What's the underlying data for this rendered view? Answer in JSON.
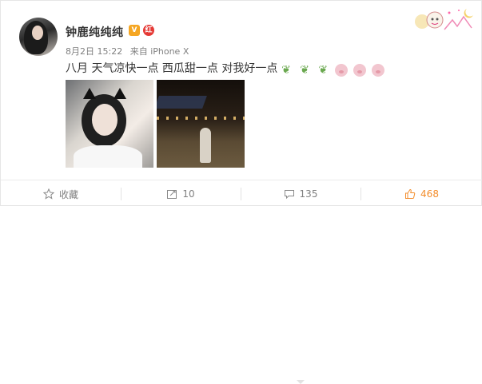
{
  "post": {
    "username": "钟鹿纯纯纯",
    "vip_badge": "V",
    "verified_badge": "红",
    "time": "8月2日 15:22",
    "source": "来自 iPhone X",
    "content": "八月 天气凉快一点  西瓜甜一点 对我好一点",
    "emojis": [
      "leaf-emoji",
      "leaf-emoji",
      "leaf-emoji",
      "pig-emoji",
      "pig-emoji",
      "pig-emoji"
    ],
    "photos": [
      "selfie-photo",
      "airport-night-photo"
    ]
  },
  "actions": {
    "favorite_label": "收藏",
    "repost_count": "10",
    "comment_count": "135",
    "like_count": "468"
  },
  "colors": {
    "like": "#f38d2c",
    "text_gray": "#808080"
  }
}
